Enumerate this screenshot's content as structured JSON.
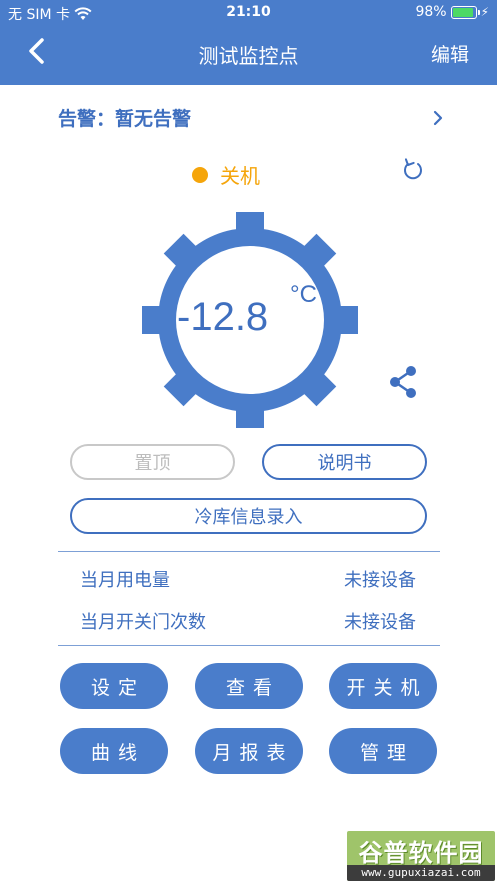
{
  "status_bar": {
    "carrier": "无 SIM 卡",
    "time": "21:10",
    "battery_percent": "98%",
    "battery_level": 0.98
  },
  "nav": {
    "title": "测试监控点",
    "edit_label": "编辑"
  },
  "alarm": {
    "text": "告警：暂无告警"
  },
  "power": {
    "status_text": "关机",
    "status_color": "#f5a50b"
  },
  "gauge": {
    "temperature": "-12.8",
    "unit": "°C",
    "color": "#4a7dcb"
  },
  "buttons": {
    "pin_label": "置顶",
    "manual_label": "说明书",
    "coldroom_label": "冷库信息录入"
  },
  "info": {
    "rows": [
      {
        "label": "当月用电量",
        "value": "未接设备"
      },
      {
        "label": "当月开关门次数",
        "value": "未接设备"
      }
    ]
  },
  "actions": [
    {
      "label": "设定"
    },
    {
      "label": "查看"
    },
    {
      "label": "开关机"
    },
    {
      "label": "曲线"
    },
    {
      "label": "月报表"
    },
    {
      "label": "管理"
    }
  ],
  "watermark": {
    "name": "谷普软件园",
    "url": "www.gupuxiazai.com"
  },
  "colors": {
    "primary": "#4a7dcb",
    "warning": "#f5a50b",
    "disabled": "#c8c8c8"
  }
}
